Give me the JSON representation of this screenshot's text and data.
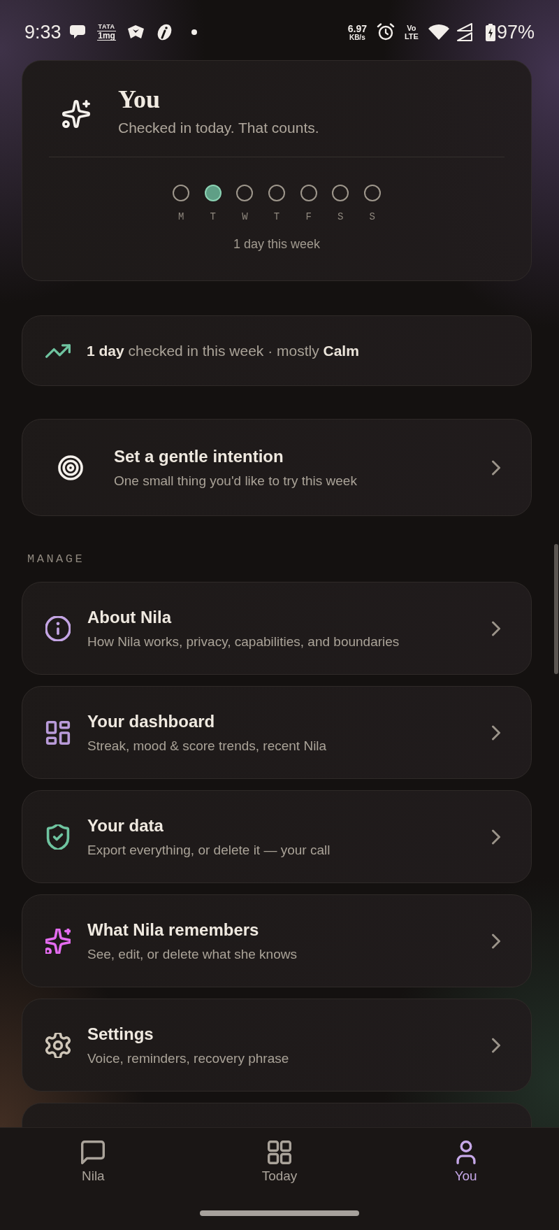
{
  "status_bar": {
    "time": "9:33",
    "app_logo": [
      "TATA",
      "1mg"
    ],
    "net_speed": {
      "value": "6.97",
      "unit": "KB/s"
    },
    "volte": [
      "Vo",
      "LTE"
    ],
    "battery": "97%"
  },
  "profile_card": {
    "title": "You",
    "subtitle": "Checked in today. That counts.",
    "week": [
      {
        "day": "M",
        "checked": false
      },
      {
        "day": "T",
        "checked": true
      },
      {
        "day": "W",
        "checked": false
      },
      {
        "day": "T",
        "checked": false
      },
      {
        "day": "F",
        "checked": false
      },
      {
        "day": "S",
        "checked": false
      },
      {
        "day": "S",
        "checked": false
      }
    ],
    "summary": "1 day this week"
  },
  "streak": {
    "text": "**1 day** checked in this week · mostly **Calm**"
  },
  "intention": {
    "title": "Set a gentle intention",
    "subtitle": "One small thing you'd like to try this week"
  },
  "manage": {
    "heading": "MANAGE",
    "items": [
      {
        "title": "About Nila",
        "subtitle": "How Nila works, privacy, capabilities, and boundaries",
        "color": "#c4a5e4"
      },
      {
        "title": "Your dashboard",
        "subtitle": "Streak, mood & score trends, recent Nila",
        "color": "#b99bd9"
      },
      {
        "title": "Your data",
        "subtitle": "Export everything, or delete it — your call",
        "color": "#6fc4a0"
      },
      {
        "title": "What Nila remembers",
        "subtitle": "See, edit, or delete what she knows",
        "color": "#e46cf0"
      },
      {
        "title": "Settings",
        "subtitle": "Voice, reminders, recovery phrase",
        "color": "#cfc6b8"
      }
    ]
  },
  "bottom_nav": {
    "tabs": [
      {
        "label": "Nila",
        "selected": false
      },
      {
        "label": "Today",
        "selected": false
      },
      {
        "label": "You",
        "selected": true
      }
    ]
  }
}
